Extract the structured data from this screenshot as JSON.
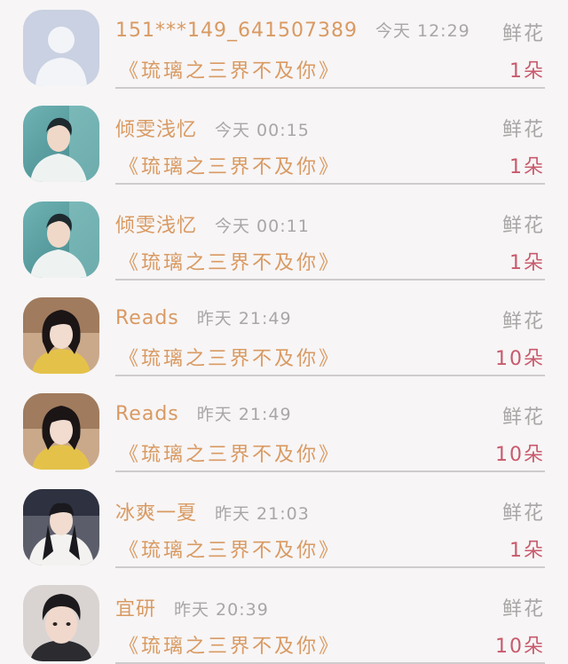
{
  "records": [
    {
      "name": "151***149_641507389",
      "time": "今天 12:29",
      "book": "《琉璃之三界不及你》",
      "gift": "鲜花",
      "count": "1朵",
      "avatar": "default-avatar-icon"
    },
    {
      "name": "倾雯浅忆",
      "time": "今天 00:15",
      "book": "《琉璃之三界不及你》",
      "gift": "鲜花",
      "count": "1朵",
      "avatar": "user-photo-teal"
    },
    {
      "name": "倾雯浅忆",
      "time": "今天 00:11",
      "book": "《琉璃之三界不及你》",
      "gift": "鲜花",
      "count": "1朵",
      "avatar": "user-photo-teal"
    },
    {
      "name": "Reads",
      "time": "昨天 21:49",
      "book": "《琉璃之三界不及你》",
      "gift": "鲜花",
      "count": "10朵",
      "avatar": "user-photo-girl"
    },
    {
      "name": "Reads",
      "time": "昨天 21:49",
      "book": "《琉璃之三界不及你》",
      "gift": "鲜花",
      "count": "10朵",
      "avatar": "user-photo-girl"
    },
    {
      "name": "冰爽一夏",
      "time": "昨天 21:03",
      "book": "《琉璃之三界不及你》",
      "gift": "鲜花",
      "count": "1朵",
      "avatar": "user-photo-white-robe"
    },
    {
      "name": "宜研",
      "time": "昨天 20:39",
      "book": "《琉璃之三界不及你》",
      "gift": "鲜花",
      "count": "10朵",
      "avatar": "user-photo-man"
    }
  ],
  "colors": {
    "accent": "#d99a62",
    "muted": "#a9a6a6",
    "count": "#c85a6c",
    "divider": "#cfcbcc",
    "background": "#f7f5f6"
  }
}
